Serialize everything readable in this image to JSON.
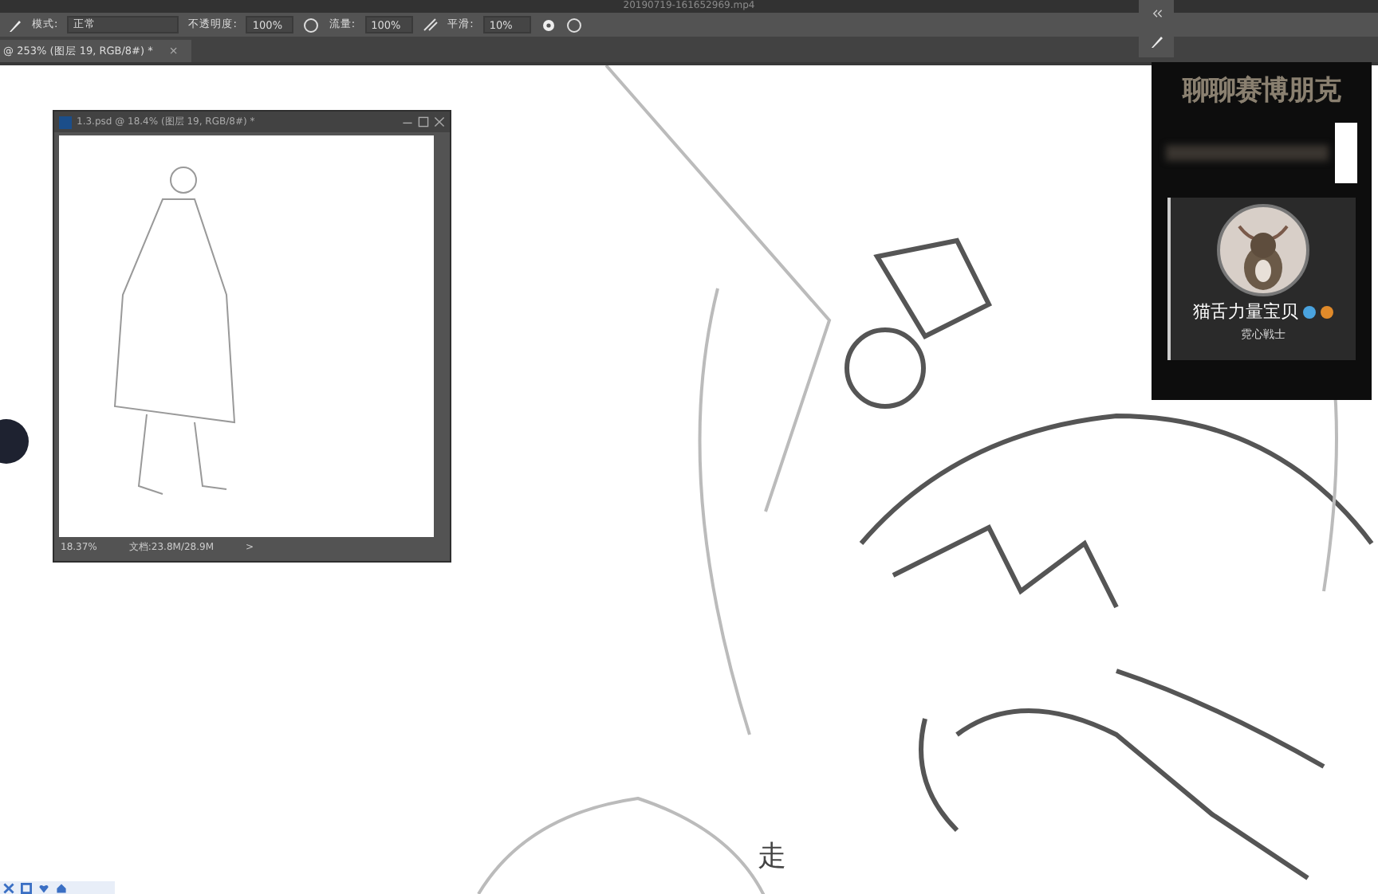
{
  "window": {
    "title": "20190719-161652969.mp4"
  },
  "options_bar": {
    "mode_label": "模式:",
    "mode_value": "正常",
    "opacity_label": "不透明度:",
    "opacity_value": "100%",
    "flow_label": "流量:",
    "flow_value": "100%",
    "smoothing_label": "平滑:",
    "smoothing_value": "10%"
  },
  "document_tab": {
    "title": "@ 253% (图层 19, RGB/8#) *",
    "close": "×",
    "selected": true
  },
  "navigator_window": {
    "title": "1.3.psd @ 18.4% (图层 19, RGB/8#) *",
    "zoom": "18.37%",
    "doc_size": "文档:23.8M/28.9M",
    "arrow": ">"
  },
  "stream_overlay": {
    "title": "聊聊赛博朋克",
    "name": "猫舌力量宝贝",
    "subtitle": "霓心戦士"
  },
  "subtitle": "走"
}
